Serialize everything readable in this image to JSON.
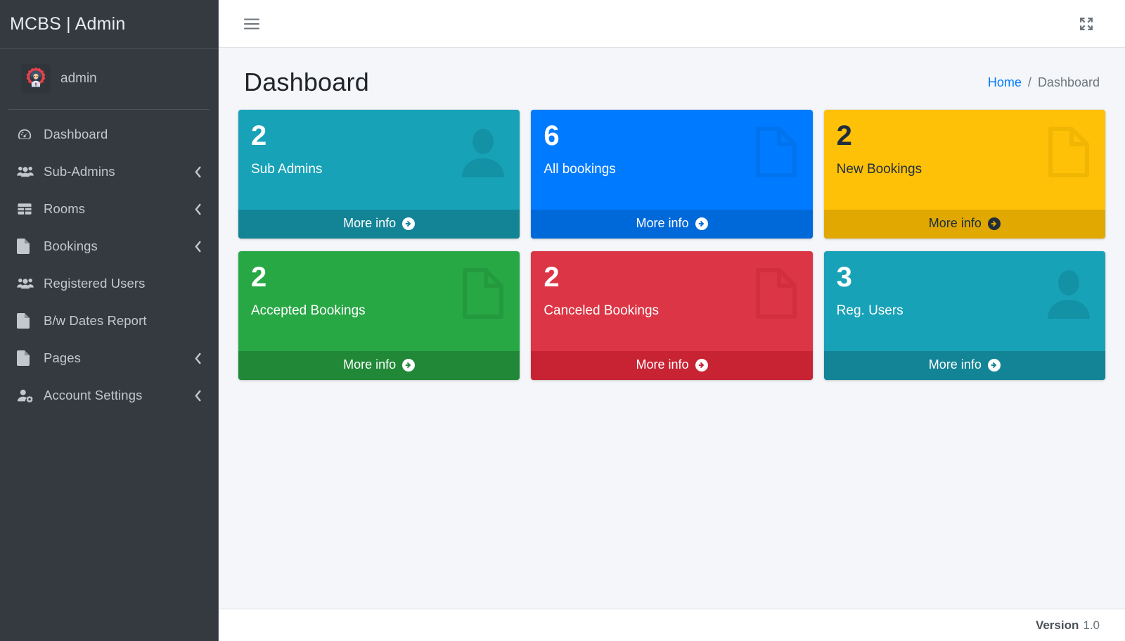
{
  "brand": {
    "title": "MCBS | Admin"
  },
  "user": {
    "name": "admin",
    "avatar_icon": "admin-gear-avatar-icon"
  },
  "sidebar": {
    "items": [
      {
        "label": "Dashboard",
        "icon": "tachometer-icon",
        "has_arrow": false
      },
      {
        "label": "Sub-Admins",
        "icon": "users-icon",
        "has_arrow": true
      },
      {
        "label": "Rooms",
        "icon": "table-grid-icon",
        "has_arrow": true
      },
      {
        "label": "Bookings",
        "icon": "file-icon",
        "has_arrow": true
      },
      {
        "label": "Registered Users",
        "icon": "users-icon",
        "has_arrow": false
      },
      {
        "label": "B/w Dates Report",
        "icon": "file-icon",
        "has_arrow": false
      },
      {
        "label": "Pages",
        "icon": "file-icon",
        "has_arrow": true
      },
      {
        "label": "Account Settings",
        "icon": "user-gear-icon",
        "has_arrow": true
      }
    ]
  },
  "topbar": {
    "menu_icon": "hamburger-icon",
    "fullscreen_icon": "expand-arrows-icon"
  },
  "header": {
    "title": "Dashboard",
    "breadcrumb": {
      "home": "Home",
      "separator": "/",
      "current": "Dashboard"
    }
  },
  "cards": [
    {
      "number": "2",
      "label": "Sub Admins",
      "more_info": "More info",
      "icon": "person-silhouette-icon",
      "bg": "#17a2b8",
      "footer_bg": "#138496",
      "text": "light"
    },
    {
      "number": "6",
      "label": "All bookings",
      "more_info": "More info",
      "icon": "file-outline-icon",
      "bg": "#007bff",
      "footer_bg": "#0069d9",
      "text": "light"
    },
    {
      "number": "2",
      "label": "New Bookings",
      "more_info": "More info",
      "icon": "file-outline-icon",
      "bg": "#ffc107",
      "footer_bg": "#e0a800",
      "text": "dark"
    },
    {
      "number": "2",
      "label": "Accepted Bookings",
      "more_info": "More info",
      "icon": "file-outline-icon",
      "bg": "#28a745",
      "footer_bg": "#218838",
      "text": "light"
    },
    {
      "number": "2",
      "label": "Canceled Bookings",
      "more_info": "More info",
      "icon": "file-outline-icon",
      "bg": "#dc3545",
      "footer_bg": "#c82333",
      "text": "light"
    },
    {
      "number": "3",
      "label": "Reg. Users",
      "more_info": "More info",
      "icon": "person-silhouette-icon",
      "bg": "#17a2b8",
      "footer_bg": "#138496",
      "text": "light"
    }
  ],
  "footer": {
    "version_label": "Version",
    "version_value": "1.0"
  },
  "colors": {
    "sidebar_bg": "#343a40",
    "content_bg": "#f4f6f9",
    "accent_link": "#007bff",
    "topbar_bg": "#ffffff"
  }
}
